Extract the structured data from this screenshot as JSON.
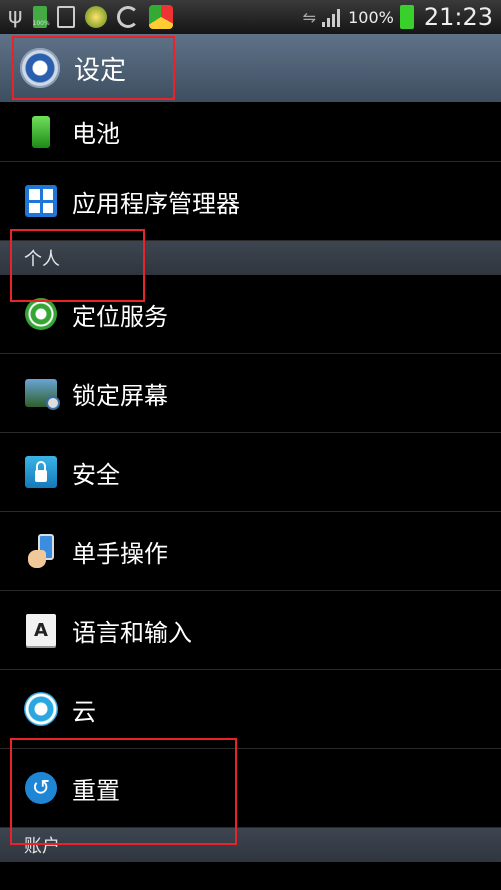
{
  "status_bar": {
    "battery_small_label": "100%",
    "battery_percent": "100%",
    "time": "21:23",
    "icons": [
      "usb-icon",
      "battery-small-icon",
      "document-icon",
      "green-app-icon",
      "moon-icon",
      "chrome-icon",
      "sync-icon",
      "signal-icon",
      "battery-icon"
    ]
  },
  "header": {
    "title": "设定"
  },
  "items": [
    {
      "label": "电池",
      "icon": "battery-icon"
    },
    {
      "label": "应用程序管理器",
      "icon": "apps-grid-icon"
    }
  ],
  "section_personal": {
    "label": "个人"
  },
  "personal_items": [
    {
      "label": "定位服务",
      "icon": "location-icon"
    },
    {
      "label": "锁定屏幕",
      "icon": "lockscreen-icon"
    },
    {
      "label": "安全",
      "icon": "lock-icon"
    },
    {
      "label": "单手操作",
      "icon": "one-hand-icon"
    },
    {
      "label": "语言和输入",
      "icon": "language-icon"
    },
    {
      "label": "云",
      "icon": "cloud-icon"
    },
    {
      "label": "重置",
      "icon": "reset-icon"
    }
  ],
  "section_accounts": {
    "label": "账户"
  },
  "colors": {
    "accent_header": "#4f6277",
    "highlight": "#e8242a",
    "section_bg": "#353c45"
  }
}
